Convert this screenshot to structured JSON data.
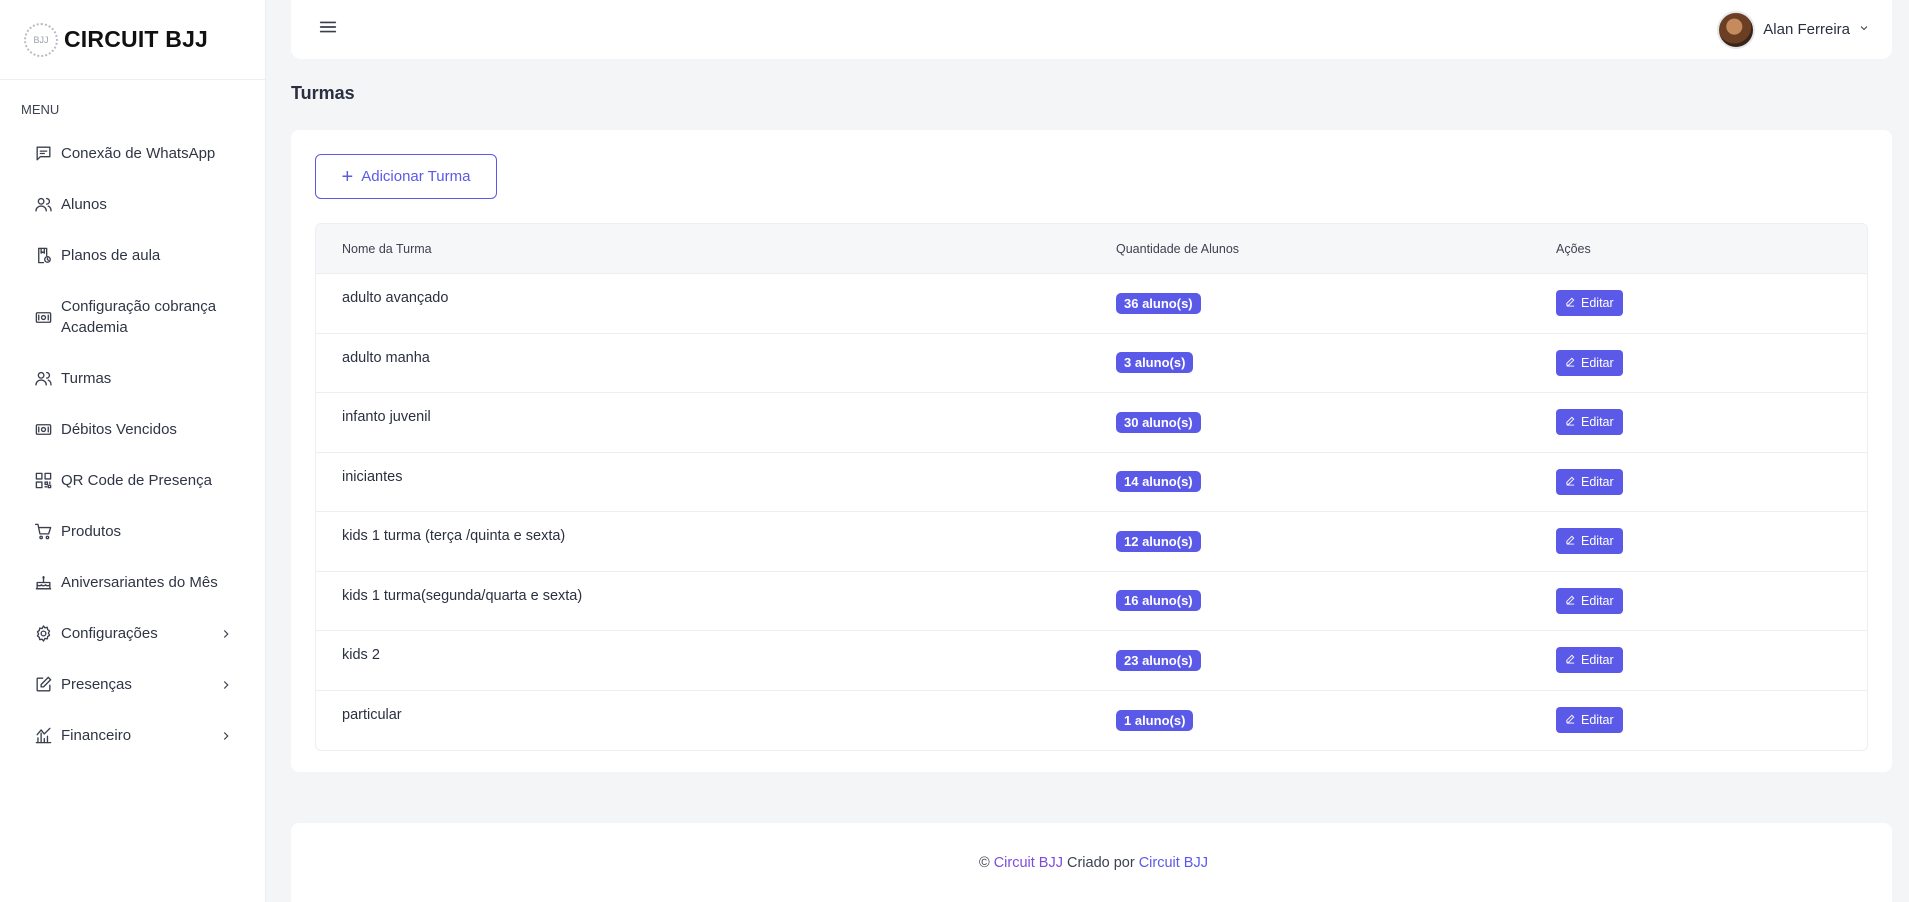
{
  "brand": {
    "name": "CIRCUIT BJJ",
    "logo_text": "BJJ"
  },
  "sidebar": {
    "heading": "MENU",
    "items": [
      {
        "label": "Conexão de WhatsApp",
        "icon": "message-icon"
      },
      {
        "label": "Alunos",
        "icon": "users-icon"
      },
      {
        "label": "Planos de aula",
        "icon": "lesson-plan-icon"
      },
      {
        "label": "Configuração cobrança Academia",
        "icon": "money-icon"
      },
      {
        "label": "Turmas",
        "icon": "users-icon"
      },
      {
        "label": "Débitos Vencidos",
        "icon": "money-icon"
      },
      {
        "label": "QR Code de Presença",
        "icon": "qrcode-icon"
      },
      {
        "label": "Produtos",
        "icon": "cart-icon"
      },
      {
        "label": "Aniversariantes do Mês",
        "icon": "cake-icon"
      },
      {
        "label": "Configurações",
        "icon": "gear-icon"
      },
      {
        "label": "Presenças",
        "icon": "edit-icon"
      },
      {
        "label": "Financeiro",
        "icon": "finance-icon"
      }
    ]
  },
  "header": {
    "user_name": "Alan Ferreira"
  },
  "page": {
    "title": "Turmas"
  },
  "main": {
    "add_button": "Adicionar Turma",
    "columns": [
      "Nome da Turma",
      "Quantidade de Alunos",
      "Ações"
    ],
    "rows": [
      {
        "name": "adulto avançado",
        "qty": "36 aluno(s)",
        "action": "Editar"
      },
      {
        "name": "adulto manha",
        "qty": "3 aluno(s)",
        "action": "Editar"
      },
      {
        "name": "infanto juvenil",
        "qty": "30 aluno(s)",
        "action": "Editar"
      },
      {
        "name": "iniciantes",
        "qty": "14 aluno(s)",
        "action": "Editar"
      },
      {
        "name": "kids 1 turma (terça /quinta e sexta)",
        "qty": "12 aluno(s)",
        "action": "Editar"
      },
      {
        "name": "kids 1 turma(segunda/quarta e sexta)",
        "qty": "16 aluno(s)",
        "action": "Editar"
      },
      {
        "name": "kids 2",
        "qty": "23 aluno(s)",
        "action": "Editar"
      },
      {
        "name": "particular",
        "qty": "1 aluno(s)",
        "action": "Editar"
      }
    ]
  },
  "footer": {
    "copyright": "©",
    "link1": "Circuit BJJ",
    "middle": "Criado por",
    "link2": "Circuit BJJ"
  },
  "colors": {
    "accent": "#5b59e8",
    "footer_link": "#7c4ddb",
    "background": "#f4f5f7"
  }
}
